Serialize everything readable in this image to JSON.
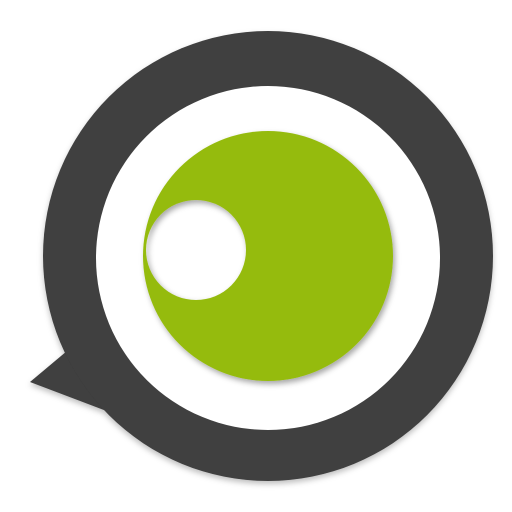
{
  "logo": {
    "name": "speech-bubble-eye-logo",
    "colors": {
      "ring": "#3f3f3f",
      "inner": "#ffffff",
      "iris": "#95bb10",
      "pupil": "#ffffff",
      "background": "#ffffff"
    }
  }
}
